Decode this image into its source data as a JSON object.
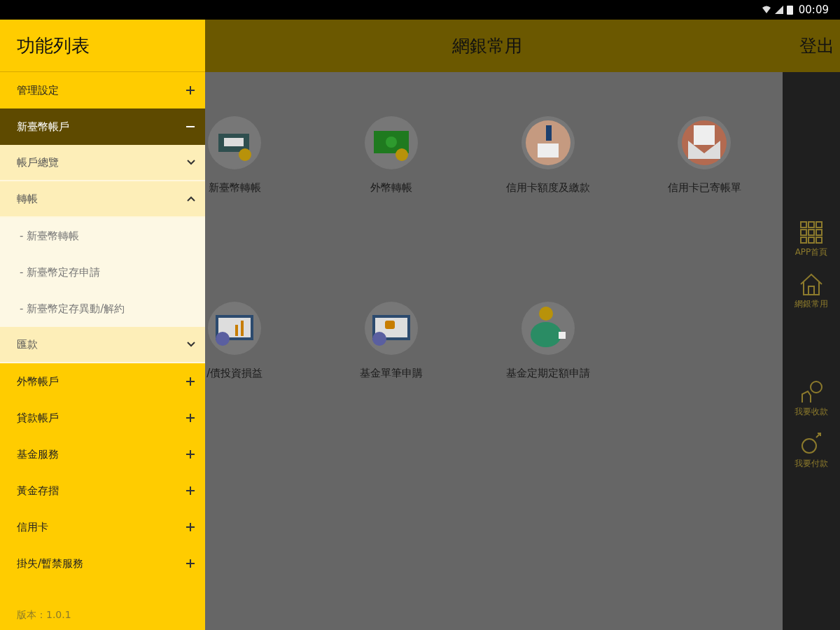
{
  "status_bar": {
    "time": "00:09"
  },
  "app_bar": {
    "title": "網銀常用",
    "logout": "登出"
  },
  "tiles": [
    {
      "label": "新臺幣轉帳",
      "kind": "transfer"
    },
    {
      "label": "外幣轉帳",
      "kind": "cash"
    },
    {
      "label": "信用卡額度及繳款",
      "kind": "payment"
    },
    {
      "label": "信用卡已寄帳單",
      "kind": "bill"
    },
    {
      "label": "/債投資損益",
      "kind": "chart"
    },
    {
      "label": "基金單筆申購",
      "kind": "screen"
    },
    {
      "label": "基金定期定額申請",
      "kind": "piggy"
    }
  ],
  "rail": [
    {
      "label": "APP首頁",
      "kind": "grid"
    },
    {
      "label": "網銀常用",
      "kind": "home"
    },
    {
      "label": "我要收款",
      "kind": "receive"
    },
    {
      "label": "我要付款",
      "kind": "pay"
    }
  ],
  "drawer": {
    "title": "功能列表",
    "version": "版本：1.0.1",
    "items": [
      {
        "label": "管理設定",
        "expanded": false
      },
      {
        "label": "新臺幣帳戶",
        "expanded": true,
        "children": [
          {
            "label": "帳戶總覽",
            "expanded": false
          },
          {
            "label": "轉帳",
            "expanded": true,
            "children": [
              {
                "label": "- 新臺幣轉帳"
              },
              {
                "label": "- 新臺幣定存申請"
              },
              {
                "label": "- 新臺幣定存異動/解約"
              }
            ]
          },
          {
            "label": "匯款",
            "expanded": false
          }
        ]
      },
      {
        "label": "外幣帳戶",
        "expanded": false
      },
      {
        "label": "貸款帳戶",
        "expanded": false
      },
      {
        "label": "基金服務",
        "expanded": false
      },
      {
        "label": "黃金存摺",
        "expanded": false
      },
      {
        "label": "信用卡",
        "expanded": false
      },
      {
        "label": "掛失/暫禁服務",
        "expanded": false
      }
    ]
  }
}
